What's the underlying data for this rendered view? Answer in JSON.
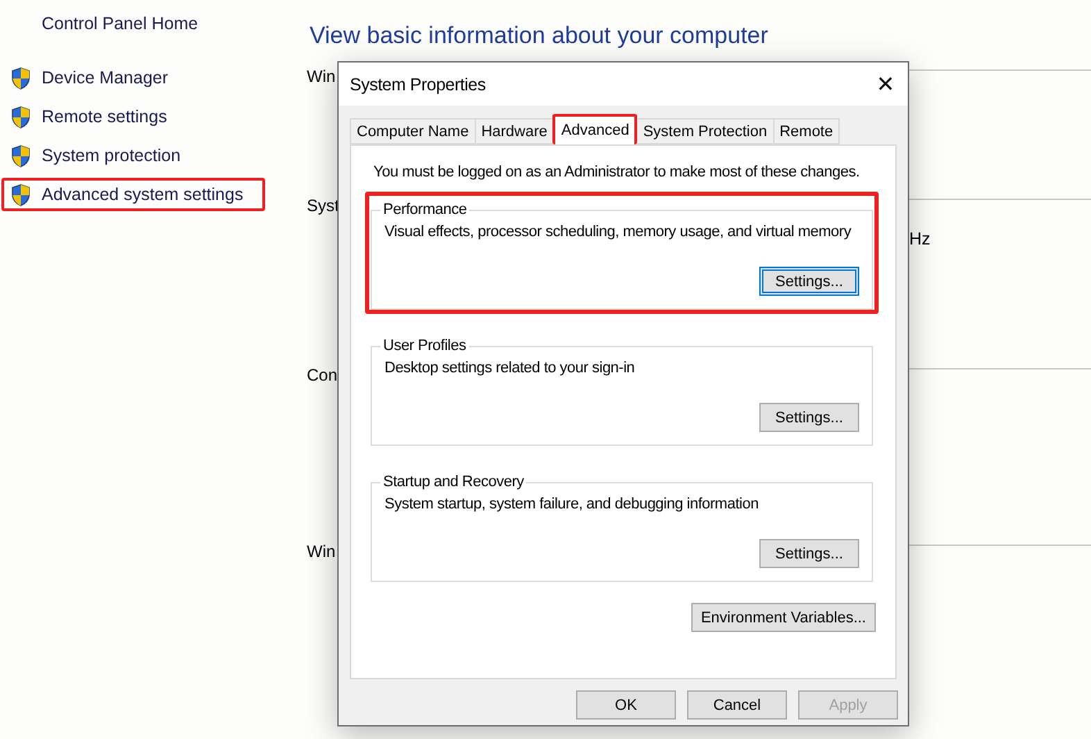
{
  "sidebar": {
    "home": "Control Panel Home",
    "items": [
      {
        "label": "Device Manager",
        "highlighted": false
      },
      {
        "label": "Remote settings",
        "highlighted": false
      },
      {
        "label": "System protection",
        "highlighted": false
      },
      {
        "label": "Advanced system settings",
        "highlighted": true
      }
    ]
  },
  "main": {
    "title": "View basic information about your computer",
    "sections": [
      {
        "heading": "Win"
      },
      {
        "heading": "Syst",
        "value": "Hz"
      },
      {
        "heading": "Con"
      },
      {
        "heading": "Win"
      }
    ]
  },
  "dialog": {
    "title": "System Properties",
    "close": "✕",
    "tabs": [
      {
        "label": "Computer Name",
        "selected": false,
        "highlighted": false
      },
      {
        "label": "Hardware",
        "selected": false,
        "highlighted": false
      },
      {
        "label": "Advanced",
        "selected": true,
        "highlighted": true
      },
      {
        "label": "System Protection",
        "selected": false,
        "highlighted": false
      },
      {
        "label": "Remote",
        "selected": false,
        "highlighted": false
      }
    ],
    "notice": "You must be logged on as an Administrator to make most of these changes.",
    "groups": [
      {
        "title": "Performance",
        "description": "Visual effects, processor scheduling, memory usage, and virtual memory",
        "button": "Settings...",
        "focused": true,
        "highlighted": true
      },
      {
        "title": "User Profiles",
        "description": "Desktop settings related to your sign-in",
        "button": "Settings...",
        "focused": false,
        "highlighted": false
      },
      {
        "title": "Startup and Recovery",
        "description": "System startup, system failure, and debugging information",
        "button": "Settings...",
        "focused": false,
        "highlighted": false
      }
    ],
    "env_button": "Environment Variables...",
    "buttons": [
      {
        "label": "OK",
        "disabled": false
      },
      {
        "label": "Cancel",
        "disabled": false
      },
      {
        "label": "Apply",
        "disabled": true
      }
    ]
  }
}
